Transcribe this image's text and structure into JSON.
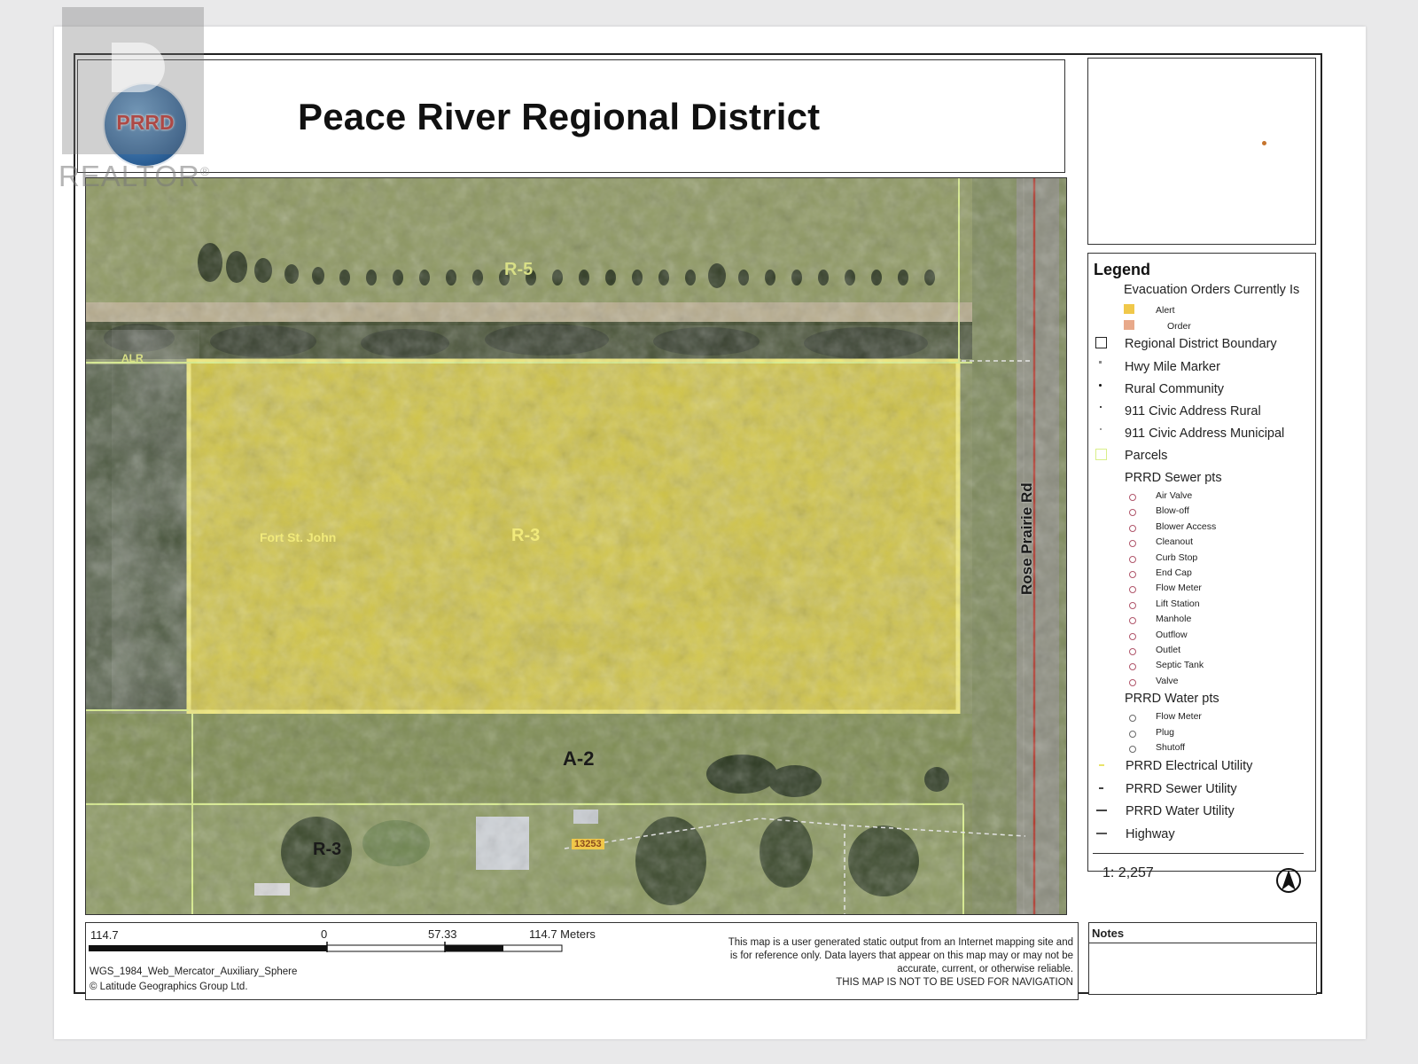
{
  "header": {
    "title": "Peace River Regional District",
    "logo_text": "PRRD"
  },
  "watermark": {
    "text": "REALTOR",
    "mark": "®"
  },
  "map": {
    "zone_labels": [
      "R-5",
      "R-3",
      "A-2",
      "R-3"
    ],
    "alr_label": "ALR",
    "community_label": "Fort St. John",
    "road_label": "Rose Prairie Rd",
    "address_label": "13253",
    "colors": {
      "highlight": "#e7db3c",
      "parcel_line": "#d9ef8a",
      "road_line": "#b03a2e"
    }
  },
  "legend": {
    "title": "Legend",
    "evacuation": "Evacuation Orders Currently Is",
    "evac_items": [
      {
        "label": "Alert",
        "color": "#f0c84a"
      },
      {
        "label": "Order",
        "color": "#e8a98a"
      }
    ],
    "layers": [
      "Regional District Boundary",
      "Hwy Mile Marker",
      "Rural Community",
      "911 Civic Address Rural",
      "911 Civic Address Municipal",
      "Parcels",
      "PRRD Sewer pts"
    ],
    "sewer_items": [
      "Air Valve",
      "Blow-off",
      "Blower Access",
      "Cleanout",
      "Curb Stop",
      "End Cap",
      "Flow Meter",
      "Lift Station",
      "Manhole",
      "Outflow",
      "Outlet",
      "Septic Tank",
      "Valve"
    ],
    "water_title": "PRRD Water pts",
    "water_items": [
      "Flow Meter",
      "Plug",
      "Shutoff"
    ],
    "utilities": [
      "PRRD Electrical Utility",
      "PRRD Sewer Utility",
      "PRRD Water Utility",
      "Highway"
    ],
    "scale": "1: 2,257"
  },
  "scalebar": {
    "labels": [
      "114.7",
      "0",
      "57.33",
      "114.7 Meters"
    ],
    "projection": "WGS_1984_Web_Mercator_Auxiliary_Sphere",
    "copyright": "© Latitude Geographics Group Ltd."
  },
  "disclaimer": {
    "lines": [
      "This map is a user generated static output from an Internet mapping site and",
      "is for reference only. Data layers that appear on this map may or may not be",
      "accurate, current, or otherwise reliable.",
      "THIS MAP IS NOT TO BE USED FOR NAVIGATION"
    ]
  },
  "notes": {
    "title": "Notes"
  }
}
